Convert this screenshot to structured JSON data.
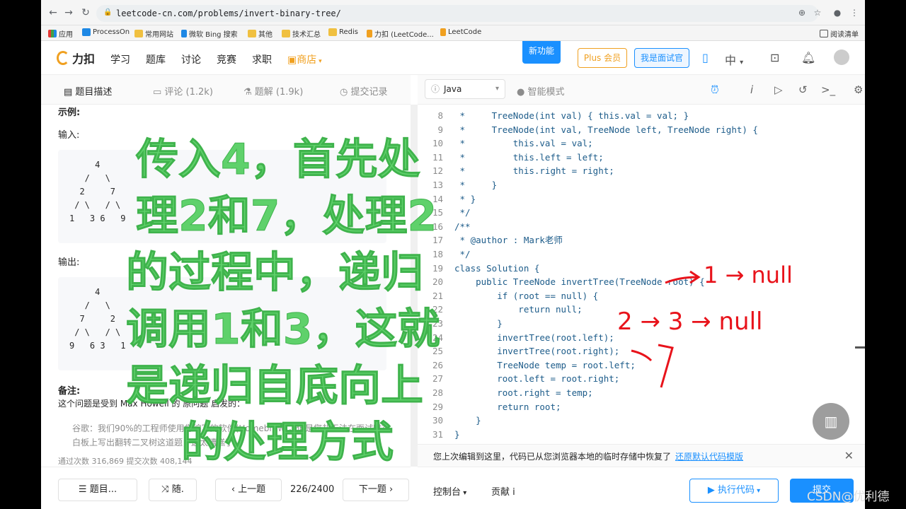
{
  "browser": {
    "url": "leetcode-cn.com/problems/invert-binary-tree/",
    "bookmarks": [
      "应用",
      "ProcessOn",
      "常用网站",
      "微软 Bing 搜索",
      "其他",
      "技术汇总",
      "Redis",
      "力扣 (LeetCode...",
      "LeetCode"
    ],
    "reading_list": "阅读清单"
  },
  "site_header": {
    "logo": "力扣",
    "nav": [
      "学习",
      "题库",
      "讨论",
      "竞赛",
      "求职"
    ],
    "store": "商店",
    "new_feature": "新功能",
    "plus": "Plus 会员",
    "interviewer": "我是面试官",
    "lang": "中"
  },
  "left_tabs": {
    "description": "题目描述",
    "comments": "评论 (1.2k)",
    "solutions": "题解 (1.9k)",
    "submissions": "提交记录"
  },
  "problem": {
    "example_title": "示例:",
    "input_label": "输入:",
    "input_tree": "     4\n   /   \\\n  2     7\n / \\   / \\\n1   3 6   9",
    "output_label": "输出:",
    "output_tree": "     4\n   /   \\\n  7     2\n / \\   / \\\n9   6 3   1",
    "note_title": "备注:",
    "note_text": "这个问题是受到 Max Howell 的 原问题 启发的：",
    "quote": "谷歌：我们90%的工程师使用您编写的软件(Homebrew)，但是您却无法在面试时在白板上写出翻转二叉树这道题，这太糟糕了。",
    "stats_partial": "通过次数 316,869    提交次数 408,144"
  },
  "left_bottom": {
    "list": "题目...",
    "random": "随.",
    "prev": "上一题",
    "counter": "226/2400",
    "next": "下一题"
  },
  "editor_toolbar": {
    "language": "Java",
    "smart_mode": "智能模式"
  },
  "code_lines": [
    {
      "n": "8",
      "text": " *     TreeNode(int val) { this.val = val; }"
    },
    {
      "n": "9",
      "text": " *     TreeNode(int val, TreeNode left, TreeNode right) {"
    },
    {
      "n": "10",
      "text": " *         this.val = val;"
    },
    {
      "n": "11",
      "text": " *         this.left = left;"
    },
    {
      "n": "12",
      "text": " *         this.right = right;"
    },
    {
      "n": "13",
      "text": " *     }"
    },
    {
      "n": "14",
      "text": " * }"
    },
    {
      "n": "15",
      "text": " */"
    },
    {
      "n": "16",
      "text": "/**"
    },
    {
      "n": "17",
      "text": " * @author : Mark老师"
    },
    {
      "n": "18",
      "text": " */"
    },
    {
      "n": "19",
      "text": "class Solution {"
    },
    {
      "n": "20",
      "text": "    public TreeNode invertTree(TreeNode root) {"
    },
    {
      "n": "21",
      "text": "        if (root == null) {"
    },
    {
      "n": "22",
      "text": "            return null;"
    },
    {
      "n": "23",
      "text": "        }"
    },
    {
      "n": "24",
      "text": "        invertTree(root.left);"
    },
    {
      "n": "25",
      "text": "        invertTree(root.right);"
    },
    {
      "n": "26",
      "text": "        TreeNode temp = root.left;"
    },
    {
      "n": "27",
      "text": "        root.left = root.right;"
    },
    {
      "n": "28",
      "text": "        root.right = temp;"
    },
    {
      "n": "29",
      "text": "        return root;"
    },
    {
      "n": "30",
      "text": "    }"
    },
    {
      "n": "31",
      "text": "}"
    }
  ],
  "restore_bar": {
    "text": "您上次编辑到这里，代码已从您浏览器本地的临时存储中恢复了",
    "link": "还原默认代码模版"
  },
  "right_bottom": {
    "console": "控制台",
    "contribute": "贡献 i",
    "run": "执行代码",
    "submit": "提交"
  },
  "overlay": {
    "lines": [
      "传入4，首先处",
      "理2和7，处理2",
      "的过程中，递归",
      "调用1和3，这就",
      "是递归自底向上",
      "的处理方式"
    ]
  },
  "handwriting": {
    "line1": "1 → null",
    "line2": "2 → 3 → null",
    "line3": "7"
  },
  "watermark": "CSDN@优利德"
}
